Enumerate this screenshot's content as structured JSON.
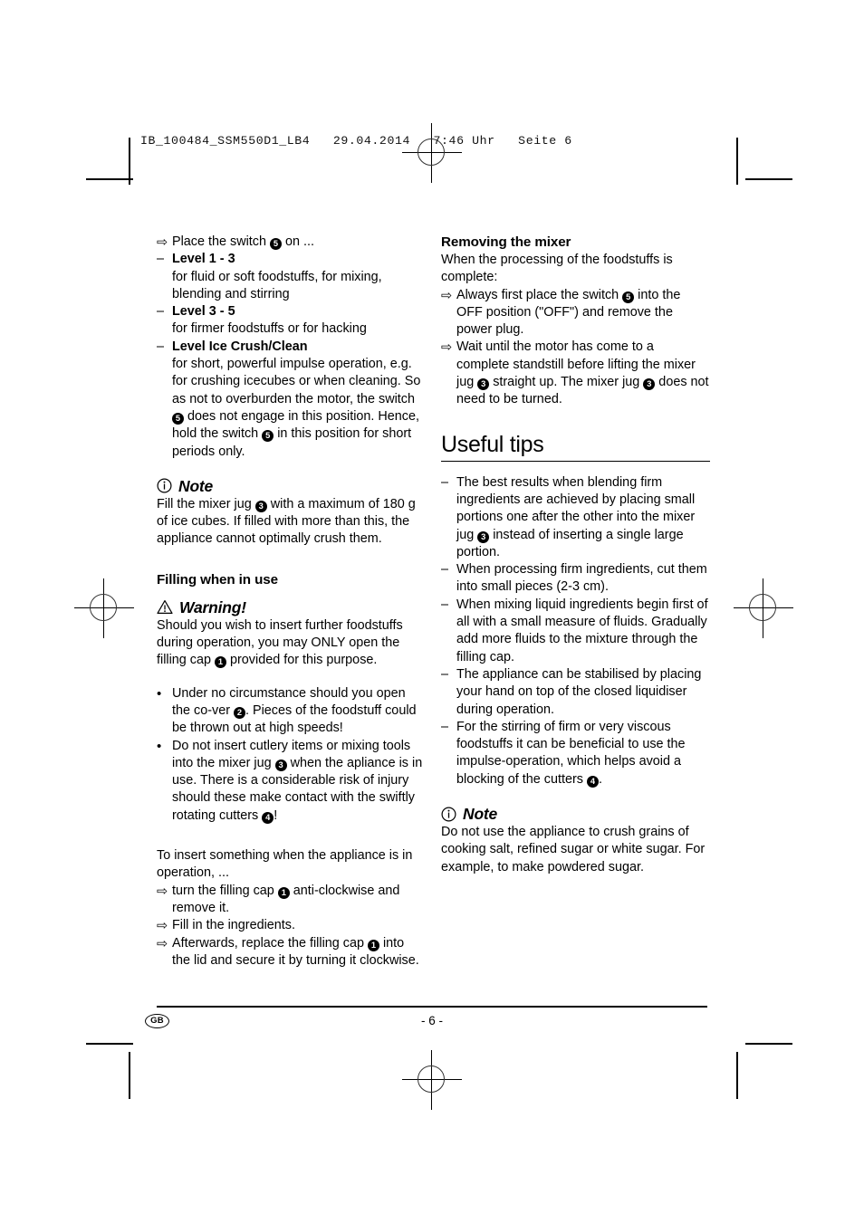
{
  "print_header": "IB_100484_SSM550D1_LB4   29.04.2014   7:46 Uhr   Seite 6",
  "glyphs": {
    "arrow": "⇨",
    "dash": "–",
    "bullet": "•"
  },
  "left_column": {
    "switch_instruction": {
      "prefix": "Place the switch ",
      "ref": "5",
      "suffix": " on ..."
    },
    "levels": [
      {
        "title": "Level 1 - 3",
        "description": "for fluid or soft foodstuffs, for mixing, blending and stirring"
      },
      {
        "title": "Level 3 - 5",
        "description": "for firmer foodstuffs or for hacking"
      },
      {
        "title": "Level Ice Crush/Clean",
        "description_part1": "for short, powerful impulse operation, e.g. for crushing icecubes or when cleaning. So as not to overburden the motor, the switch ",
        "ref1": "5",
        "description_part2": " does not engage in this position. Hence, hold the switch ",
        "ref2": "5",
        "description_part3": " in this position for short periods only."
      }
    ],
    "note_1": {
      "title": "Note",
      "icon": "info-circle-icon",
      "text_part1": "Fill the mixer jug ",
      "ref": "3",
      "text_part2": " with a maximum of 180 g of ice cubes. If filled with more than this, the appliance cannot optimally crush them."
    },
    "filling_heading": "Filling when in use",
    "warning": {
      "title": "Warning!",
      "icon": "warning-triangle-icon",
      "text_part1": "Should you wish to insert further foodstuffs during operation, you may ONLY open the filling cap ",
      "ref": "1",
      "text_part2": " provided for this purpose."
    },
    "bullets": [
      {
        "part1": "Under no circumstance should you open the co-ver ",
        "ref": "2",
        "part2": ". Pieces of the foodstuff could be thrown out at high speeds!"
      },
      {
        "part1": "Do not insert cutlery items or mixing tools into the mixer jug ",
        "ref1": "3",
        "part2": " when the apliance is in use. There is a considerable risk of injury should these make contact with the swiftly rotating cutters ",
        "ref2": "4",
        "part3": "!"
      }
    ],
    "insert_intro": "To insert something when the appliance is in operation, ...",
    "insert_steps": [
      {
        "part1": "turn the filling cap ",
        "ref": "1",
        "part2": " anti-clockwise and remove it."
      },
      {
        "part1": "Fill in the ingredients.",
        "ref": null,
        "part2": ""
      },
      {
        "part1": "Afterwards, replace the filling cap ",
        "ref": "1",
        "part2": " into the lid and secure it by turning it clockwise."
      }
    ]
  },
  "right_column": {
    "removing_heading": "Removing the mixer",
    "removing_intro": "When the processing of the foodstuffs is complete:",
    "removing_steps": [
      {
        "part1": "Always first place the switch ",
        "ref1": "5",
        "part2": " into the OFF position (\"OFF\") and remove the power plug.",
        "ref2": null,
        "part3": ""
      },
      {
        "part1": "Wait until the motor has come to a complete standstill before lifting the mixer jug ",
        "ref1": "3",
        "part2": " straight up. The mixer jug ",
        "ref2": "3",
        "part3": " does not need to be turned."
      }
    ],
    "useful_tips_heading": "Useful tips",
    "tips": [
      {
        "part1": "The best results when blending firm ingredients are achieved by placing small portions one after the other into the mixer jug ",
        "ref": "3",
        "part2": " instead of inserting a single large portion."
      },
      {
        "part1": "When processing firm ingredients, cut them into small pieces (2-3 cm).",
        "ref": null,
        "part2": ""
      },
      {
        "part1": "When mixing liquid ingredients begin first of all with a small measure of fluids. Gradually add more fluids to the mixture through the filling cap.",
        "ref": null,
        "part2": ""
      },
      {
        "part1": "The appliance can be stabilised by placing your hand on top of the closed liquidiser during operation.",
        "ref": null,
        "part2": ""
      },
      {
        "part1": "For the stirring of firm or very viscous foodstuffs it can be beneficial to use the impulse-operation, which helps avoid a blocking of the cutters ",
        "ref": "4",
        "part2": "."
      }
    ],
    "note_2": {
      "title": "Note",
      "icon": "info-circle-icon",
      "text": "Do not use the appliance to crush grains of cooking salt, refined sugar or white sugar. For example, to make powdered sugar."
    }
  },
  "footer": {
    "language_badge": "GB",
    "page_number": "- 6 -"
  }
}
